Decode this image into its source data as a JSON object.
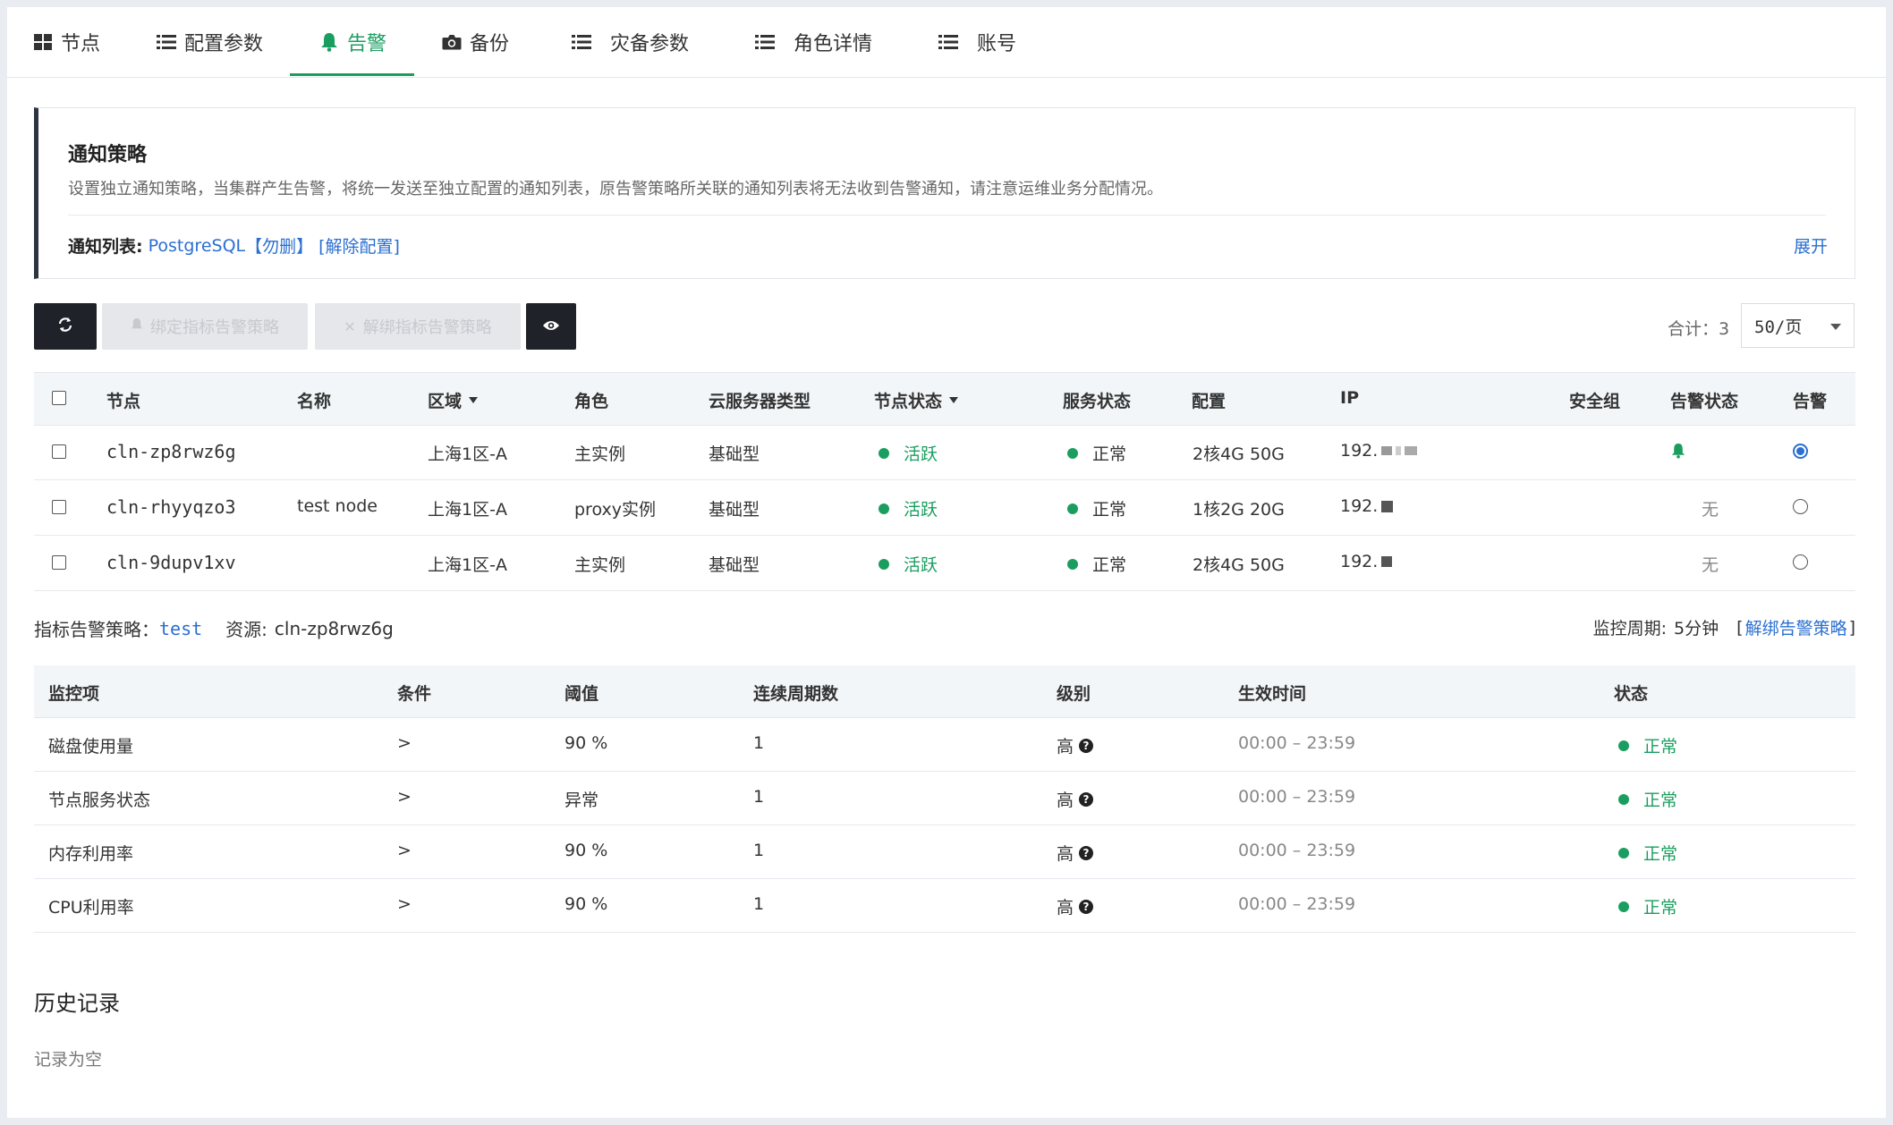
{
  "tabs": [
    {
      "label": "节点",
      "icon": "grid-icon"
    },
    {
      "label": "配置参数",
      "icon": "list-icon"
    },
    {
      "label": "告警",
      "icon": "bell-icon",
      "active": true
    },
    {
      "label": "备份",
      "icon": "camera-icon"
    },
    {
      "label": "灾备参数",
      "icon": "list-icon"
    },
    {
      "label": "角色详情",
      "icon": "list-icon"
    },
    {
      "label": "账号",
      "icon": "list-icon"
    }
  ],
  "notice": {
    "title": "通知策略",
    "desc": "设置独立通知策略，当集群产生告警，将统一发送至独立配置的通知列表，原告警策略所关联的通知列表将无法收到告警通知，请注意运维业务分配情况。",
    "list_label": "通知列表:",
    "list_value": "PostgreSQL",
    "delete_link": "【勿删】",
    "unbind_link": "[解除配置]",
    "expand": "展开"
  },
  "toolbar": {
    "bind_label": "绑定指标告警策略",
    "unbind_label": "解绑指标告警策略",
    "total": "合计：3",
    "page_size": "50/页"
  },
  "nodes_table": {
    "headers": {
      "node": "节点",
      "name": "名称",
      "zone": "区域",
      "role": "角色",
      "server_type": "云服务器类型",
      "node_status": "节点状态",
      "service_status": "服务状态",
      "config": "配置",
      "ip": "IP",
      "security_group": "安全组",
      "alarm_status": "告警状态",
      "alarm": "告警"
    },
    "rows": [
      {
        "node": "cln-zp8rwz6g",
        "name": "",
        "zone": "上海1区-A",
        "role": "主实例",
        "server_type": "基础型",
        "node_status": "活跃",
        "service_status": "正常",
        "config": "2核4G 50G",
        "ip": "192.",
        "alarm_status": "",
        "alarm_selected": true
      },
      {
        "node": "cln-rhyyqzo3",
        "name": "test node",
        "zone": "上海1区-A",
        "role": "proxy实例",
        "server_type": "基础型",
        "node_status": "活跃",
        "service_status": "正常",
        "config": "1核2G 20G",
        "ip": "192.",
        "alarm_status": "无",
        "alarm_selected": false
      },
      {
        "node": "cln-9dupv1xv",
        "name": "",
        "zone": "上海1区-A",
        "role": "主实例",
        "server_type": "基础型",
        "node_status": "活跃",
        "service_status": "正常",
        "config": "2核4G 50G",
        "ip": "192.",
        "alarm_status": "无",
        "alarm_selected": false
      }
    ]
  },
  "policy": {
    "label": "指标告警策略：",
    "name": "test",
    "resource_label": "资源:",
    "resource": "cln-zp8rwz6g",
    "period_label": "监控周期:",
    "period": "5分钟",
    "unbind_link": "解绑告警策略"
  },
  "metrics_table": {
    "headers": {
      "item": "监控项",
      "condition": "条件",
      "threshold": "阈值",
      "periods": "连续周期数",
      "level": "级别",
      "time": "生效时间",
      "status": "状态"
    },
    "rows": [
      {
        "item": "磁盘使用量",
        "condition": ">",
        "threshold": "90 %",
        "periods": "1",
        "level": "高",
        "time": "00:00 – 23:59",
        "status": "正常"
      },
      {
        "item": "节点服务状态",
        "condition": ">",
        "threshold": "异常",
        "periods": "1",
        "level": "高",
        "time": "00:00 – 23:59",
        "status": "正常"
      },
      {
        "item": "内存利用率",
        "condition": ">",
        "threshold": "90 %",
        "periods": "1",
        "level": "高",
        "time": "00:00 – 23:59",
        "status": "正常"
      },
      {
        "item": "CPU利用率",
        "condition": ">",
        "threshold": "90 %",
        "periods": "1",
        "level": "高",
        "time": "00:00 – 23:59",
        "status": "正常"
      }
    ]
  },
  "history": {
    "title": "历史记录",
    "empty": "记录为空"
  },
  "colors": {
    "accent": "#1a9e5f",
    "link": "#2a6fd1",
    "dark": "#1f2329"
  }
}
